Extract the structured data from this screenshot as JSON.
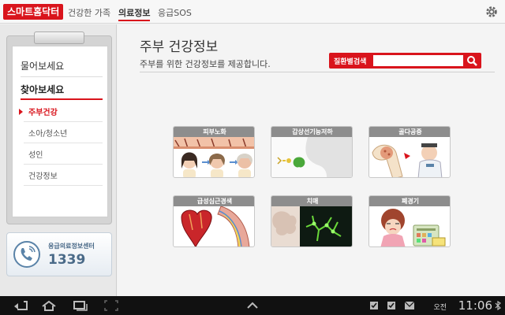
{
  "topnav": {
    "brand": "스마트홈닥터",
    "items": [
      "건강한 가족",
      "의료정보",
      "응급SOS"
    ],
    "active_index": 1
  },
  "sidebar": {
    "menu": [
      "물어보세요",
      "찾아보세요"
    ],
    "active_menu": "찾아보세요",
    "submenu": [
      "주부건강",
      "소아/청소년",
      "성인",
      "건강정보"
    ],
    "active_submenu": "주부건강",
    "hotline_label": "응급의료정보센터",
    "hotline_number": "1339"
  },
  "main": {
    "title": "주부 건강정보",
    "subtitle": "주부를 위한 건강정보를 제공합니다.",
    "search_label": "질환별검색",
    "search_value": "",
    "cards": [
      "피부노화",
      "갑상선기능저하",
      "골다공증",
      "급성심근경색",
      "치매",
      "폐경기"
    ]
  },
  "statusbar": {
    "ampm": "오전",
    "time": "11:06"
  },
  "colors": {
    "accent": "#d9141c",
    "card_header": "#8d8d8d",
    "hotline": "#4a6a88"
  }
}
